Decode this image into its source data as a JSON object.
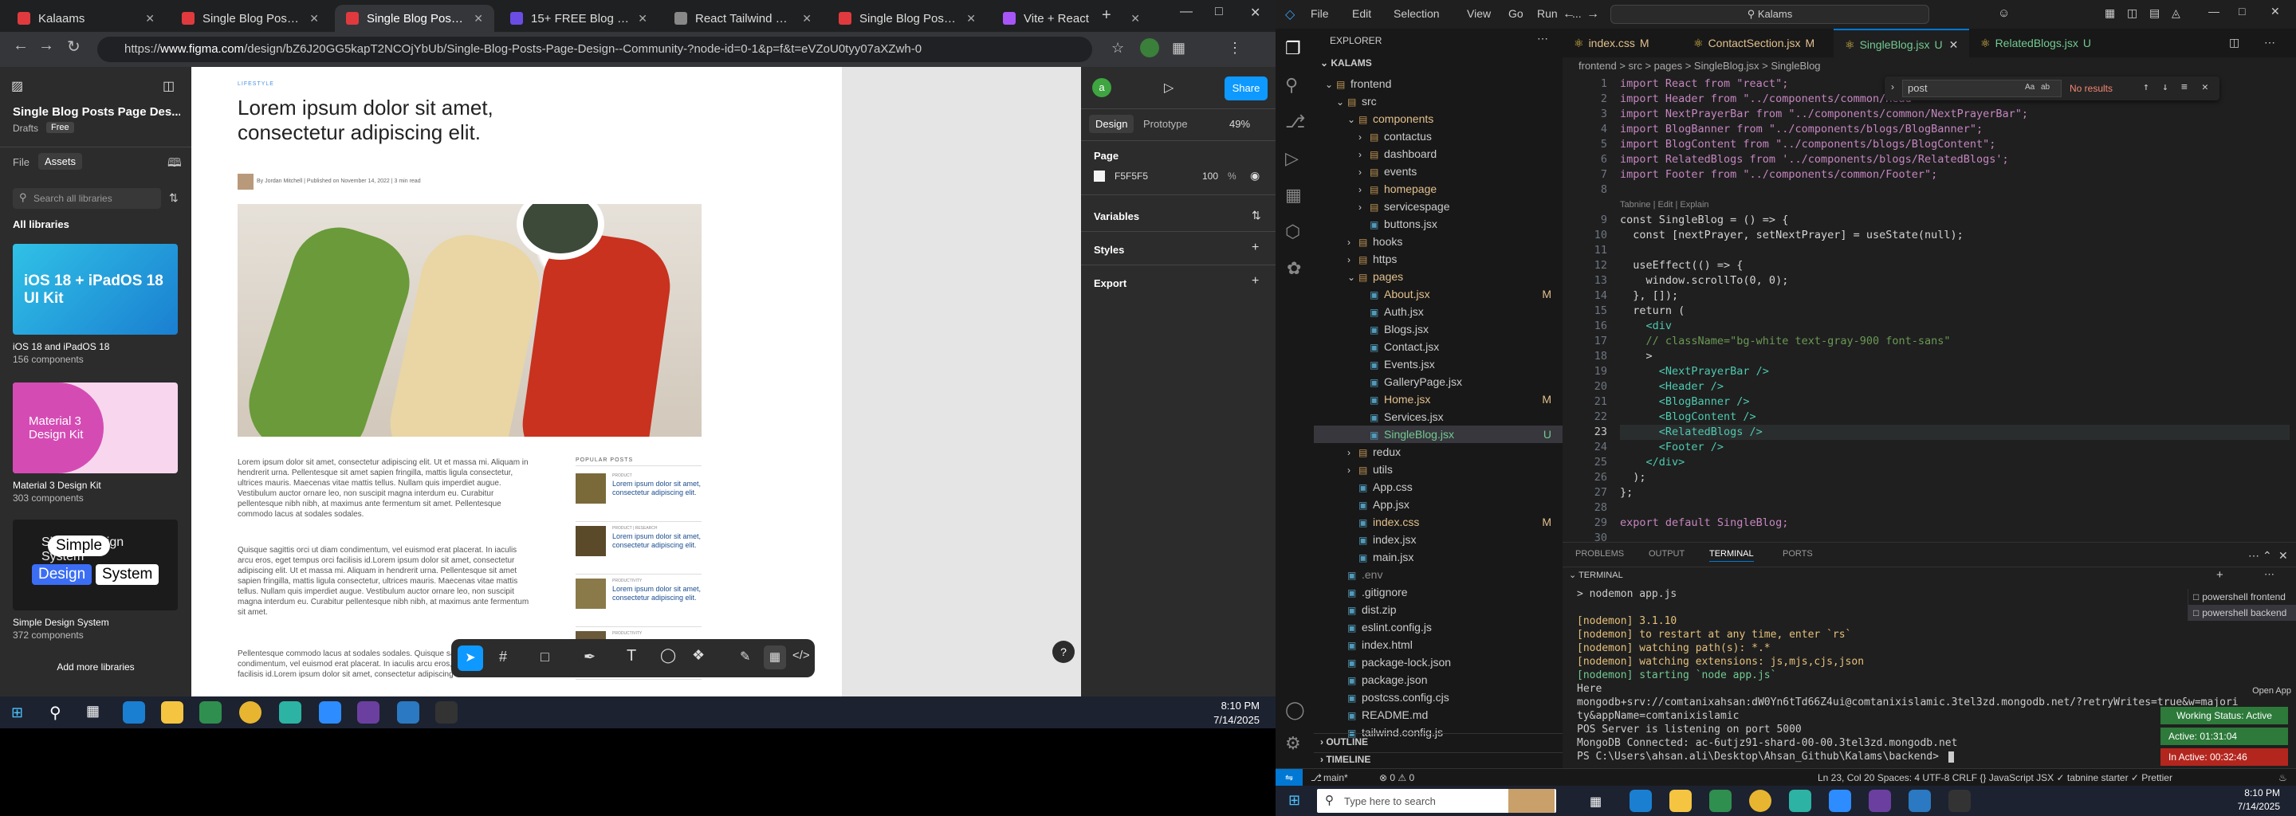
{
  "browser": {
    "tabs": [
      {
        "label": "Kalaams",
        "color": "#e03a3e"
      },
      {
        "label": "Single Blog Posts Page",
        "color": "#e03a3e"
      },
      {
        "label": "Single Blog Posts Page",
        "color": "#e03a3e"
      },
      {
        "label": "15+ FREE Blog Websi",
        "color": "#6b4de6"
      },
      {
        "label": "React Tailwind Blog Co",
        "color": "#888888"
      },
      {
        "label": "Single Blog Posts Page",
        "color": "#e03a3e"
      },
      {
        "label": "Vite + React",
        "color": "#a855f7"
      }
    ],
    "url_prefix": "https://",
    "url_host": "www.figma.com",
    "url_path": "/design/bZ6J20GG5kapT2NCOjYbUb/Single-Blog-Posts-Page-Design--Community-?node-id=0-1&p=f&t=eVZoU0tyy07aXZwh-0"
  },
  "figma_left": {
    "file_title": "Single Blog Posts Page Des...",
    "drafts": "Drafts",
    "free_badge": "Free",
    "tab_file": "File",
    "tab_assets": "Assets",
    "search_placeholder": "Search all libraries",
    "all_libraries": "All libraries",
    "libraries": [
      {
        "name": "iOS 18 and iPadOS 18",
        "count": "156 components",
        "thumb_title": "iOS 18 + iPadOS 18 UI Kit"
      },
      {
        "name": "Material 3 Design Kit",
        "count": "303 components",
        "thumb_title": "Material 3 Design Kit"
      },
      {
        "name": "Simple Design System",
        "count": "372 components",
        "thumb_title": "Simple Design System"
      }
    ],
    "add_more": "Add more libraries"
  },
  "blog": {
    "category": "LIFESTYLE",
    "title_line1": "Lorem ipsum dolor sit amet,",
    "title_line2": "consectetur adipiscing elit.",
    "author_line": "By Jordan Mitchell  |  Published on November 14, 2022  |  3 min read",
    "paragraph1": [
      "Lorem ipsum dolor sit amet, consectetur adipiscing elit. Ut et massa mi. Aliquam in",
      "hendrerit urna. Pellentesque sit amet sapien fringilla, mattis ligula consectetur,",
      "ultrices mauris. Maecenas vitae mattis tellus. Nullam quis imperdiet augue.",
      "Vestibulum auctor ornare leo, non suscipit magna interdum eu. Curabitur",
      "pellentesque nibh nibh, at maximus ante fermentum sit amet. Pellentesque",
      "commodo lacus at sodales sodales."
    ],
    "paragraph2": [
      "Quisque sagittis orci ut diam condimentum, vel euismod erat placerat. In iaculis",
      "arcu eros, eget tempus orci facilisis id.Lorem ipsum dolor sit amet, consectetur",
      "adipiscing elit. Ut et massa mi. Aliquam in hendrerit urna. Pellentesque sit amet",
      "sapien fringilla, mattis ligula consectetur, ultrices mauris. Maecenas vitae mattis",
      "tellus. Nullam quis imperdiet augue. Vestibulum auctor ornare leo, non suscipit",
      "magna interdum eu. Curabitur pellentesque nibh nibh, at maximus ante fermentum",
      "sit amet."
    ],
    "paragraph3": [
      "Pellentesque commodo lacus at sodales sodales. Quisque sagittis orci ut diam",
      "condimentum, vel euismod erat placerat. In iaculis arcu eros, eget tempus orci",
      "facilisis id.Lorem ipsum dolor sit amet, consectetur adipiscing elit. Ut et massa mi."
    ],
    "popular_heading": "POPULAR POSTS",
    "popular": [
      {
        "tag": "PRODUCT",
        "title": "Lorem ipsum dolor sit amet, consectetur adipiscing elit."
      },
      {
        "tag": "PRODUCT  |  RESEARCH",
        "title": "Lorem ipsum dolor sit amet, consectetur adipiscing elit."
      },
      {
        "tag": "PRODUCTIVITY",
        "title": "Lorem ipsum dolor sit amet, consectetur adipiscing elit."
      },
      {
        "tag": "PRODUCTIVITY",
        "title": ""
      }
    ]
  },
  "figma_right": {
    "avatar": "a",
    "share": "Share",
    "tab_design": "Design",
    "tab_prototype": "Prototype",
    "zoom": "49%",
    "page_label": "Page",
    "page_color": "F5F5F5",
    "page_opacity": "100",
    "percent": "%",
    "variables": "Variables",
    "styles": "Styles",
    "export": "Export",
    "help": "?"
  },
  "left_taskbar": {
    "time": "8:10 PM",
    "date": "7/14/2025"
  },
  "vscode": {
    "menu": [
      "File",
      "Edit",
      "Selection",
      "View",
      "Go",
      "Run",
      "..."
    ],
    "search": "Kalams",
    "explorer_title": "EXPLORER",
    "root": "KALAMS",
    "tree": [
      {
        "name": "frontend",
        "indent": 1,
        "kind": "folder-open",
        "badge": "",
        "color": "#cccccc"
      },
      {
        "name": "src",
        "indent": 2,
        "kind": "folder-open",
        "badge": "",
        "color": "#cccccc"
      },
      {
        "name": "components",
        "indent": 3,
        "kind": "folder-open",
        "badge": "",
        "color": "#e2c08d"
      },
      {
        "name": "contactus",
        "indent": 4,
        "kind": "folder",
        "badge": "",
        "color": "#cccccc"
      },
      {
        "name": "dashboard",
        "indent": 4,
        "kind": "folder",
        "badge": "",
        "color": "#cccccc"
      },
      {
        "name": "events",
        "indent": 4,
        "kind": "folder",
        "badge": "",
        "color": "#cccccc"
      },
      {
        "name": "homepage",
        "indent": 4,
        "kind": "folder",
        "badge": "",
        "color": "#e2c08d"
      },
      {
        "name": "servicespage",
        "indent": 4,
        "kind": "folder",
        "badge": "",
        "color": "#cccccc"
      },
      {
        "name": "buttons.jsx",
        "indent": 4,
        "kind": "file",
        "badge": "",
        "color": "#cccccc"
      },
      {
        "name": "hooks",
        "indent": 3,
        "kind": "folder",
        "badge": "",
        "color": "#cccccc"
      },
      {
        "name": "https",
        "indent": 3,
        "kind": "folder",
        "badge": "",
        "color": "#cccccc"
      },
      {
        "name": "pages",
        "indent": 3,
        "kind": "folder-open",
        "badge": "",
        "color": "#e2c08d"
      },
      {
        "name": "About.jsx",
        "indent": 4,
        "kind": "file",
        "badge": "M",
        "color": "#e2c08d"
      },
      {
        "name": "Auth.jsx",
        "indent": 4,
        "kind": "file",
        "badge": "",
        "color": "#cccccc"
      },
      {
        "name": "Blogs.jsx",
        "indent": 4,
        "kind": "file",
        "badge": "",
        "color": "#cccccc"
      },
      {
        "name": "Contact.jsx",
        "indent": 4,
        "kind": "file",
        "badge": "",
        "color": "#cccccc"
      },
      {
        "name": "Events.jsx",
        "indent": 4,
        "kind": "file",
        "badge": "",
        "color": "#cccccc"
      },
      {
        "name": "GalleryPage.jsx",
        "indent": 4,
        "kind": "file",
        "badge": "",
        "color": "#cccccc"
      },
      {
        "name": "Home.jsx",
        "indent": 4,
        "kind": "file",
        "badge": "M",
        "color": "#e2c08d"
      },
      {
        "name": "Services.jsx",
        "indent": 4,
        "kind": "file",
        "badge": "",
        "color": "#cccccc"
      },
      {
        "name": "SingleBlog.jsx",
        "indent": 4,
        "kind": "file",
        "badge": "U",
        "color": "#73c991"
      },
      {
        "name": "redux",
        "indent": 3,
        "kind": "folder",
        "badge": "",
        "color": "#cccccc"
      },
      {
        "name": "utils",
        "indent": 3,
        "kind": "folder",
        "badge": "",
        "color": "#cccccc"
      },
      {
        "name": "App.css",
        "indent": 3,
        "kind": "file",
        "badge": "",
        "color": "#cccccc"
      },
      {
        "name": "App.jsx",
        "indent": 3,
        "kind": "file",
        "badge": "",
        "color": "#cccccc"
      },
      {
        "name": "index.css",
        "indent": 3,
        "kind": "file",
        "badge": "M",
        "color": "#e2c08d"
      },
      {
        "name": "index.jsx",
        "indent": 3,
        "kind": "file",
        "badge": "",
        "color": "#cccccc"
      },
      {
        "name": "main.jsx",
        "indent": 3,
        "kind": "file",
        "badge": "",
        "color": "#cccccc"
      },
      {
        "name": ".env",
        "indent": 2,
        "kind": "file",
        "badge": "",
        "color": "#8b8b8b"
      },
      {
        "name": ".gitignore",
        "indent": 2,
        "kind": "file",
        "badge": "",
        "color": "#cccccc"
      },
      {
        "name": "dist.zip",
        "indent": 2,
        "kind": "file",
        "badge": "",
        "color": "#cccccc"
      },
      {
        "name": "eslint.config.js",
        "indent": 2,
        "kind": "file",
        "badge": "",
        "color": "#cccccc"
      },
      {
        "name": "index.html",
        "indent": 2,
        "kind": "file",
        "badge": "",
        "color": "#cccccc"
      },
      {
        "name": "package-lock.json",
        "indent": 2,
        "kind": "file",
        "badge": "",
        "color": "#cccccc"
      },
      {
        "name": "package.json",
        "indent": 2,
        "kind": "file",
        "badge": "",
        "color": "#cccccc"
      },
      {
        "name": "postcss.config.cjs",
        "indent": 2,
        "kind": "file",
        "badge": "",
        "color": "#cccccc"
      },
      {
        "name": "README.md",
        "indent": 2,
        "kind": "file",
        "badge": "",
        "color": "#cccccc"
      },
      {
        "name": "tailwind.config.js",
        "indent": 2,
        "kind": "file",
        "badge": "",
        "color": "#cccccc"
      }
    ],
    "outline": "OUTLINE",
    "timeline": "TIMELINE",
    "editor_tabs": [
      {
        "label": "index.css",
        "badge": "M"
      },
      {
        "label": "ContactSection.jsx",
        "badge": "M"
      },
      {
        "label": "SingleBlog.jsx",
        "badge": "U"
      },
      {
        "label": "RelatedBlogs.jsx",
        "badge": "U"
      }
    ],
    "breadcrumb": "frontend > src > pages > SingleBlog.jsx > SingleBlog",
    "find_value": "post",
    "find_result": "No results",
    "code_lines": [
      {
        "n": "1",
        "t": "import React from \"react\";"
      },
      {
        "n": "2",
        "t": "import Header from \"../components/common/Head"
      },
      {
        "n": "3",
        "t": "import NextPrayerBar from \"../components/common/NextPrayerBar\";"
      },
      {
        "n": "4",
        "t": "import BlogBanner from \"../components/blogs/BlogBanner\";"
      },
      {
        "n": "5",
        "t": "import BlogContent from \"../components/blogs/BlogContent\";"
      },
      {
        "n": "6",
        "t": "import RelatedBlogs from '../components/blogs/RelatedBlogs';"
      },
      {
        "n": "7",
        "t": "import Footer from \"../components/common/Footer\";"
      },
      {
        "n": "8",
        "t": ""
      },
      {
        "n": "",
        "t": "Tabnine | Edit | Explain"
      },
      {
        "n": "9",
        "t": "const SingleBlog = () => {"
      },
      {
        "n": "10",
        "t": "  const [nextPrayer, setNextPrayer] = useState(null);"
      },
      {
        "n": "11",
        "t": ""
      },
      {
        "n": "12",
        "t": "  useEffect(() => {"
      },
      {
        "n": "13",
        "t": "    window.scrollTo(0, 0);"
      },
      {
        "n": "14",
        "t": "  }, []);"
      },
      {
        "n": "15",
        "t": "  return ("
      },
      {
        "n": "16",
        "t": "    <div"
      },
      {
        "n": "17",
        "t": "    // className=\"bg-white text-gray-900 font-sans\""
      },
      {
        "n": "18",
        "t": "    >"
      },
      {
        "n": "19",
        "t": "      <NextPrayerBar />"
      },
      {
        "n": "20",
        "t": "      <Header />"
      },
      {
        "n": "21",
        "t": "      <BlogBanner />"
      },
      {
        "n": "22",
        "t": "      <BlogContent />"
      },
      {
        "n": "23",
        "t": "      <RelatedBlogs />"
      },
      {
        "n": "24",
        "t": "      <Footer />"
      },
      {
        "n": "25",
        "t": "    </div>"
      },
      {
        "n": "26",
        "t": "  );"
      },
      {
        "n": "27",
        "t": "};"
      },
      {
        "n": "28",
        "t": ""
      },
      {
        "n": "29",
        "t": "export default SingleBlog;"
      },
      {
        "n": "30",
        "t": ""
      }
    ],
    "panel_tabs": [
      "PROBLEMS",
      "OUTPUT",
      "TERMINAL",
      "PORTS"
    ],
    "terminal_label": "TERMINAL",
    "terminal_lines": [
      "> nodemon app.js",
      "",
      "[nodemon] 3.1.10",
      "[nodemon] to restart at any time, enter `rs`",
      "[nodemon] watching path(s): *.*",
      "[nodemon] watching extensions: js,mjs,cjs,json",
      "[nodemon] starting `node app.js`",
      "Here",
      "mongodb+srv://comtanixahsan:dW0Yn6tTd66Z4ui@comtanixislamic.3tel3zd.mongodb.net/?retryWrites=true&w=majori",
      "ty&appName=comtanixislamic",
      "POS Server is listening on port 5000",
      "MongoDB Connected: ac-6utjz91-shard-00-00.3tel3zd.mongodb.net",
      "PS C:\\Users\\ahsan.ali\\Desktop\\Ahsan_Github\\Kalams\\backend> "
    ],
    "shells": [
      "powershell  frontend",
      "powershell  backend"
    ],
    "open_app": "Open App",
    "working_status": "Working Status: Active",
    "active_time": "Active: 01:31:04",
    "inactive_time": "In Active: 00:32:46",
    "status_left": "main*",
    "status_errors": "⊗ 0 ⚠ 0",
    "status_right": "Ln 23, Col 20   Spaces: 4   UTF-8   CRLF   {} JavaScript JSX   ✓ tabnine starter   ✓ Prettier",
    "win_search_placeholder": "Type here to search",
    "time": "8:10 PM",
    "date": "7/14/2025"
  }
}
